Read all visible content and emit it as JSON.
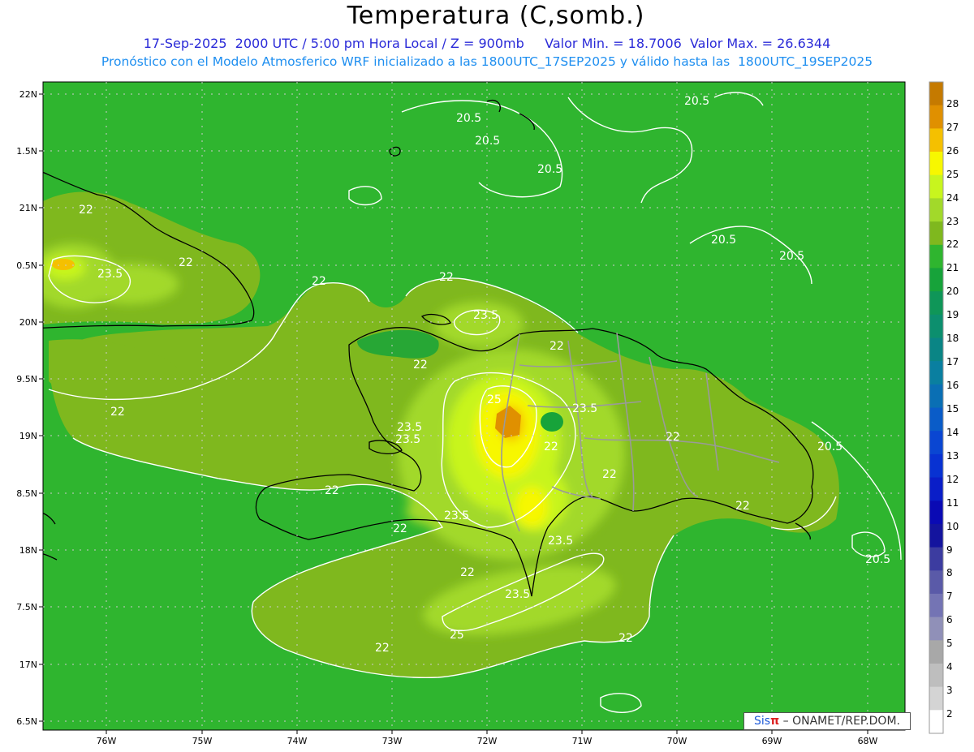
{
  "header": {
    "title": "Temperatura (C,somb.)",
    "line1": "17-Sep-2025  2000 UTC / 5:00 pm Hora Local / Z = 900mb     Valor Min. = 18.7006  Valor Max. = 26.6344",
    "line2": "Pronóstico con el Modelo Atmosferico WRF inicializado a las 1800UTC_17SEP2025 y válido hasta las  1800UTC_19SEP2025"
  },
  "axes": {
    "lat_labels": [
      "22N",
      "1.5N",
      "21N",
      "0.5N",
      "20N",
      "9.5N",
      "19N",
      "8.5N",
      "18N",
      "7.5N",
      "17N",
      "6.5N"
    ],
    "lon_labels": [
      "76W",
      "75W",
      "74W",
      "73W",
      "72W",
      "71W",
      "70W",
      "69W",
      "68W"
    ]
  },
  "colorbar": {
    "labels": [
      "28",
      "27",
      "26",
      "25",
      "24",
      "23",
      "22",
      "21",
      "20",
      "19",
      "18",
      "17",
      "16",
      "15",
      "14",
      "13",
      "12",
      "11",
      "10",
      "9",
      "8",
      "7",
      "6",
      "5",
      "4",
      "3",
      "2"
    ],
    "colors": [
      "#c57a00",
      "#e09000",
      "#f5c000",
      "#f7f700",
      "#c8f51e",
      "#a2d92a",
      "#7fb81e",
      "#2fb52f",
      "#17a33a",
      "#0f9658",
      "#0c8f6e",
      "#0a8585",
      "#0a7fa0",
      "#0a6fb4",
      "#0a5cc8",
      "#0a46d2",
      "#0832d2",
      "#0a1ec8",
      "#0a0ab4",
      "#14149e",
      "#3c3ca0",
      "#5a5aa8",
      "#7474b4",
      "#9090b8",
      "#a8a8a8",
      "#bebebe",
      "#d4d4d4",
      "#ffffff"
    ]
  },
  "contour_labels": [
    "20.5",
    "20.5",
    "20.5",
    "20.5",
    "20.5",
    "20.5",
    "20.5",
    "20.5",
    "22",
    "22",
    "22",
    "22",
    "22",
    "22",
    "22",
    "22",
    "22",
    "22",
    "22",
    "22",
    "22",
    "22",
    "22",
    "22",
    "23.5",
    "23.5",
    "23.5",
    "23.5",
    "23.5",
    "23.5",
    "23.5",
    "23.5",
    "25"
  ],
  "credit": {
    "brand": "Sis",
    "pi": "π",
    "text": "– ONAMET/REP.DOM."
  }
}
